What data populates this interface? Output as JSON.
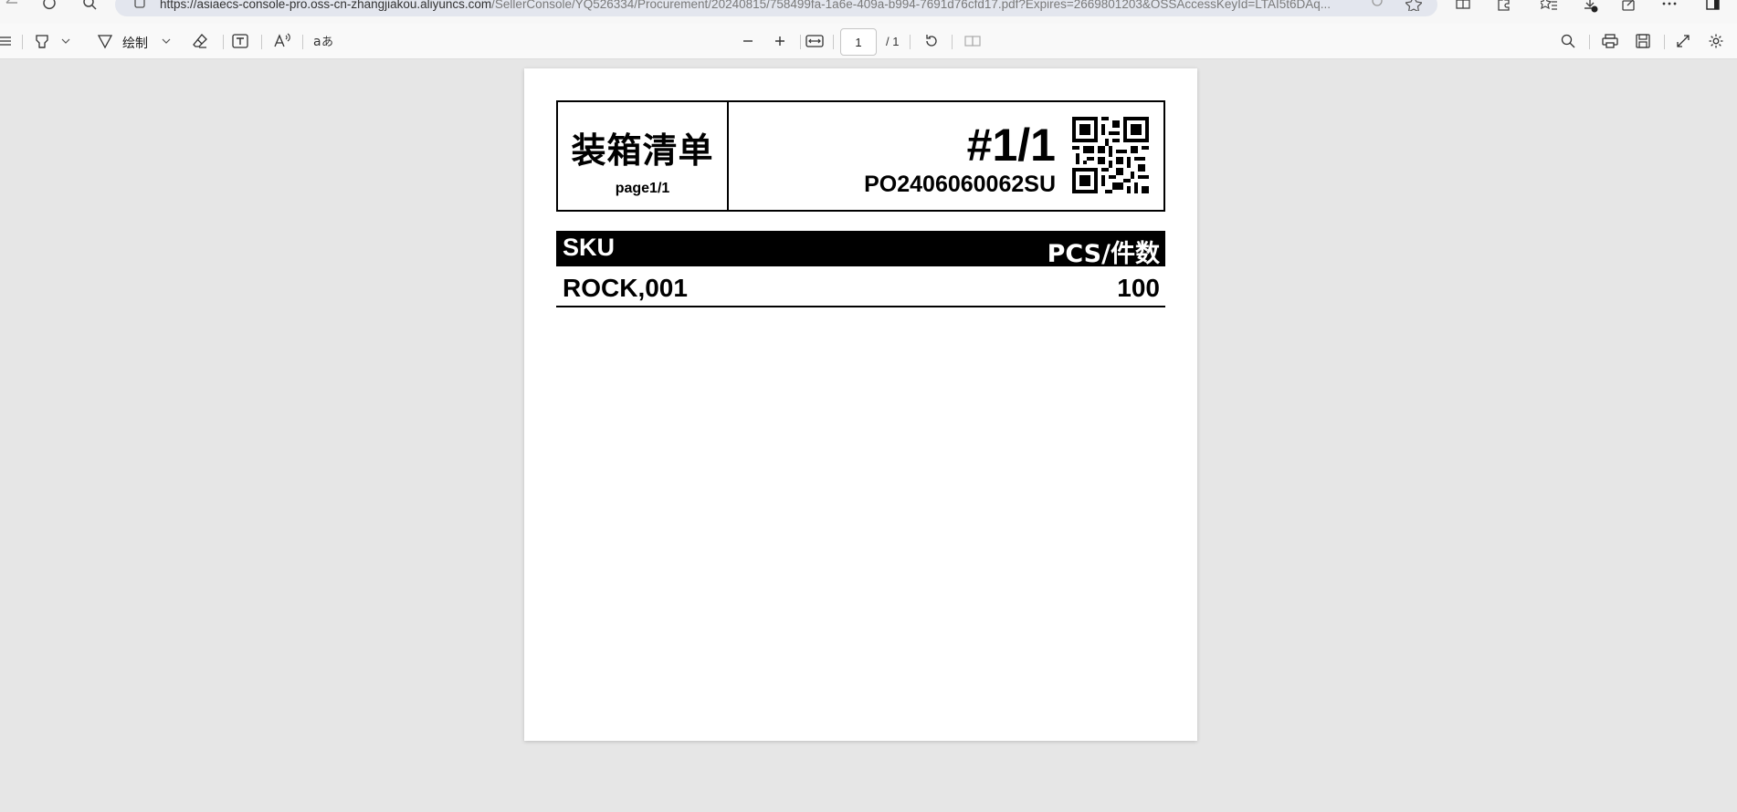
{
  "browser": {
    "url_host": "https://asiaecs-console-pro.oss-cn-zhangjiakou.aliyuncs.com",
    "url_path": "/SellerConsole/YQ526334/Procurement/20240815/758499fa-1a6e-409a-b994-7691d76cfd17.pdf?Expires=2669801203&OSSAccessKeyId=LTAI5t6DAq..."
  },
  "toolbar": {
    "draw_label": "绘制",
    "page_current": "1",
    "page_total": "/ 1"
  },
  "document": {
    "title": "装箱清单",
    "page_label": "page1/1",
    "box_number": "#1/1",
    "po_number": "PO2406060062SU",
    "columns": {
      "sku": "SKU",
      "pcs": "PCS/件数"
    },
    "rows": [
      {
        "sku": "ROCK,001",
        "pcs": "100"
      }
    ]
  }
}
